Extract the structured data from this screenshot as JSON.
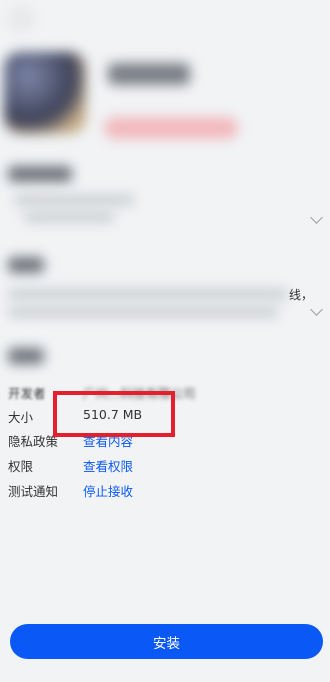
{
  "details": {
    "developer_label": "开发者",
    "developer_value": "广州…科技有限公司",
    "size_label": "大小",
    "size_value": "510.7 MB",
    "privacy_label": "隐私政策",
    "privacy_link": "查看内容",
    "permissions_label": "权限",
    "permissions_link": "查看权限",
    "test_notify_label": "测试通知",
    "test_notify_link": "停止接收"
  },
  "description_tail": "线，",
  "install_button": "安装",
  "colors": {
    "accent": "#0a59f7",
    "highlight": "#e5202e",
    "background": "#f1f3f5"
  }
}
